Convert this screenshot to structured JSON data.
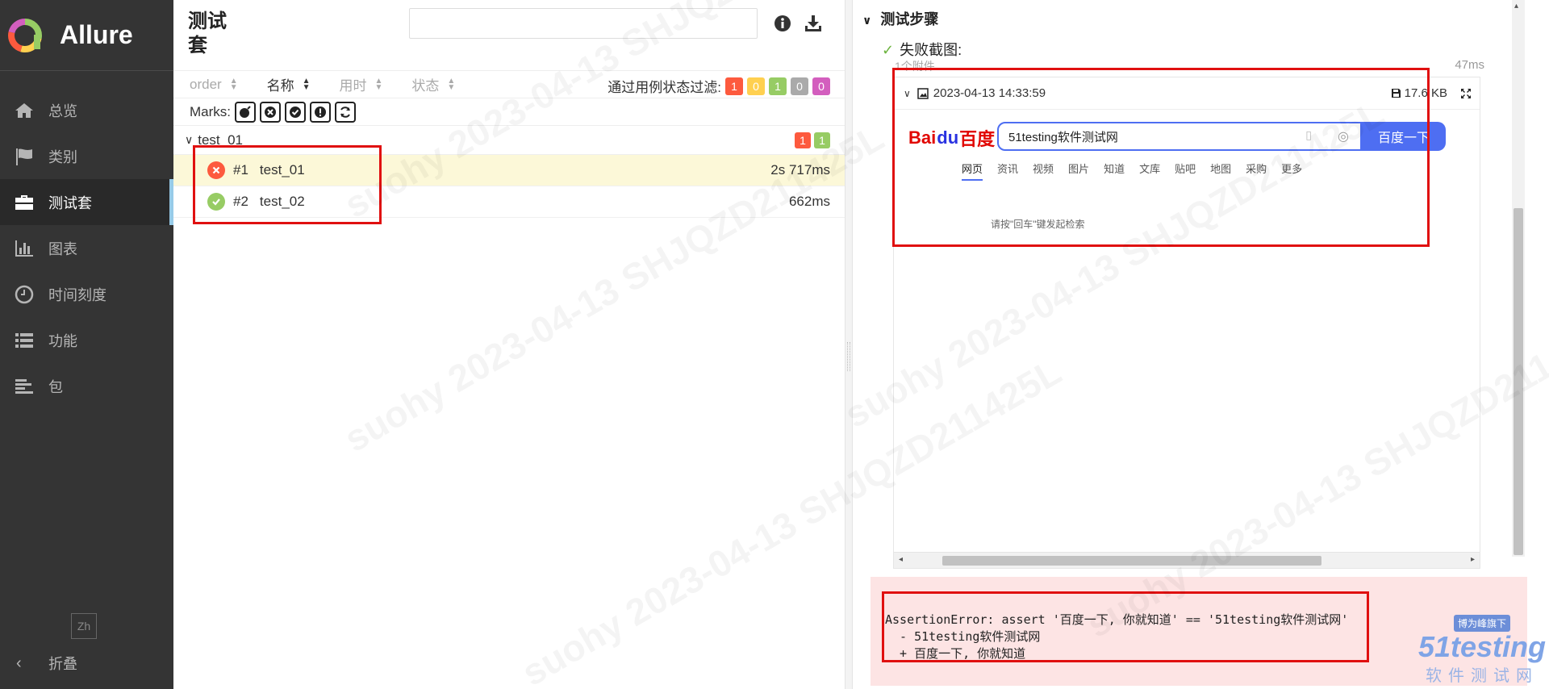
{
  "brand": {
    "name": "Allure"
  },
  "sidebar": {
    "items": [
      {
        "label": "总览",
        "icon": "home-icon"
      },
      {
        "label": "类别",
        "icon": "flag-icon"
      },
      {
        "label": "测试套",
        "icon": "briefcase-icon",
        "active": true
      },
      {
        "label": "图表",
        "icon": "bar-chart-icon"
      },
      {
        "label": "时间刻度",
        "icon": "clock-icon"
      },
      {
        "label": "功能",
        "icon": "list-icon"
      },
      {
        "label": "包",
        "icon": "align-left-icon"
      }
    ],
    "lang": "Zh",
    "collapse_label": "折叠"
  },
  "suites": {
    "title": "测试套",
    "search_value": "",
    "sort": [
      {
        "label": "order",
        "active": false
      },
      {
        "label": "名称",
        "active": true
      },
      {
        "label": "用时",
        "active": false
      },
      {
        "label": "状态",
        "active": false
      }
    ],
    "filter_label": "通过用例状态过滤:",
    "filter_badges": [
      {
        "value": "1",
        "color": "#fd5a3e"
      },
      {
        "value": "0",
        "color": "#ffd050"
      },
      {
        "value": "1",
        "color": "#97cc64"
      },
      {
        "value": "0",
        "color": "#aaaaaa"
      },
      {
        "value": "0",
        "color": "#d35ebe"
      }
    ],
    "marks_label": "Marks:",
    "group": {
      "name": "test_01",
      "badges": [
        {
          "value": "1",
          "color": "#fd5a3e"
        },
        {
          "value": "1",
          "color": "#97cc64"
        }
      ]
    },
    "rows": [
      {
        "num": "#1",
        "name": "test_01",
        "duration": "2s 717ms",
        "status": "failed"
      },
      {
        "num": "#2",
        "name": "test_02",
        "duration": "662ms",
        "status": "passed"
      }
    ]
  },
  "details": {
    "steps_title": "测试步骤",
    "failure_step": "失败截图:",
    "attach_count": "1个附件",
    "attach_time": "47ms",
    "attachment": {
      "name": "2023-04-13 14:33:59",
      "size": "17.6 KB"
    },
    "screenshot": {
      "logo_left": "Bai",
      "logo_mid": "du",
      "logo_right": "百度",
      "search_value": "51testing软件测试网",
      "button": "百度一下",
      "tabs": [
        "网页",
        "资讯",
        "视频",
        "图片",
        "知道",
        "文库",
        "贴吧",
        "地图",
        "采购",
        "更多"
      ],
      "hint": "请按\"回车\"键发起检索"
    },
    "error": {
      "line1": "AssertionError: assert '百度一下, 你就知道' == '51testing软件测试网'",
      "line2": "  - 51testing软件测试网",
      "line3": "  + 百度一下, 你就知道"
    }
  },
  "watermark": {
    "text": "suohy 2023-04-13 SHJQZD211425L",
    "site_slogan": "博为峰旗下",
    "site_name": "51testing",
    "site_sub": "软件测试网"
  }
}
